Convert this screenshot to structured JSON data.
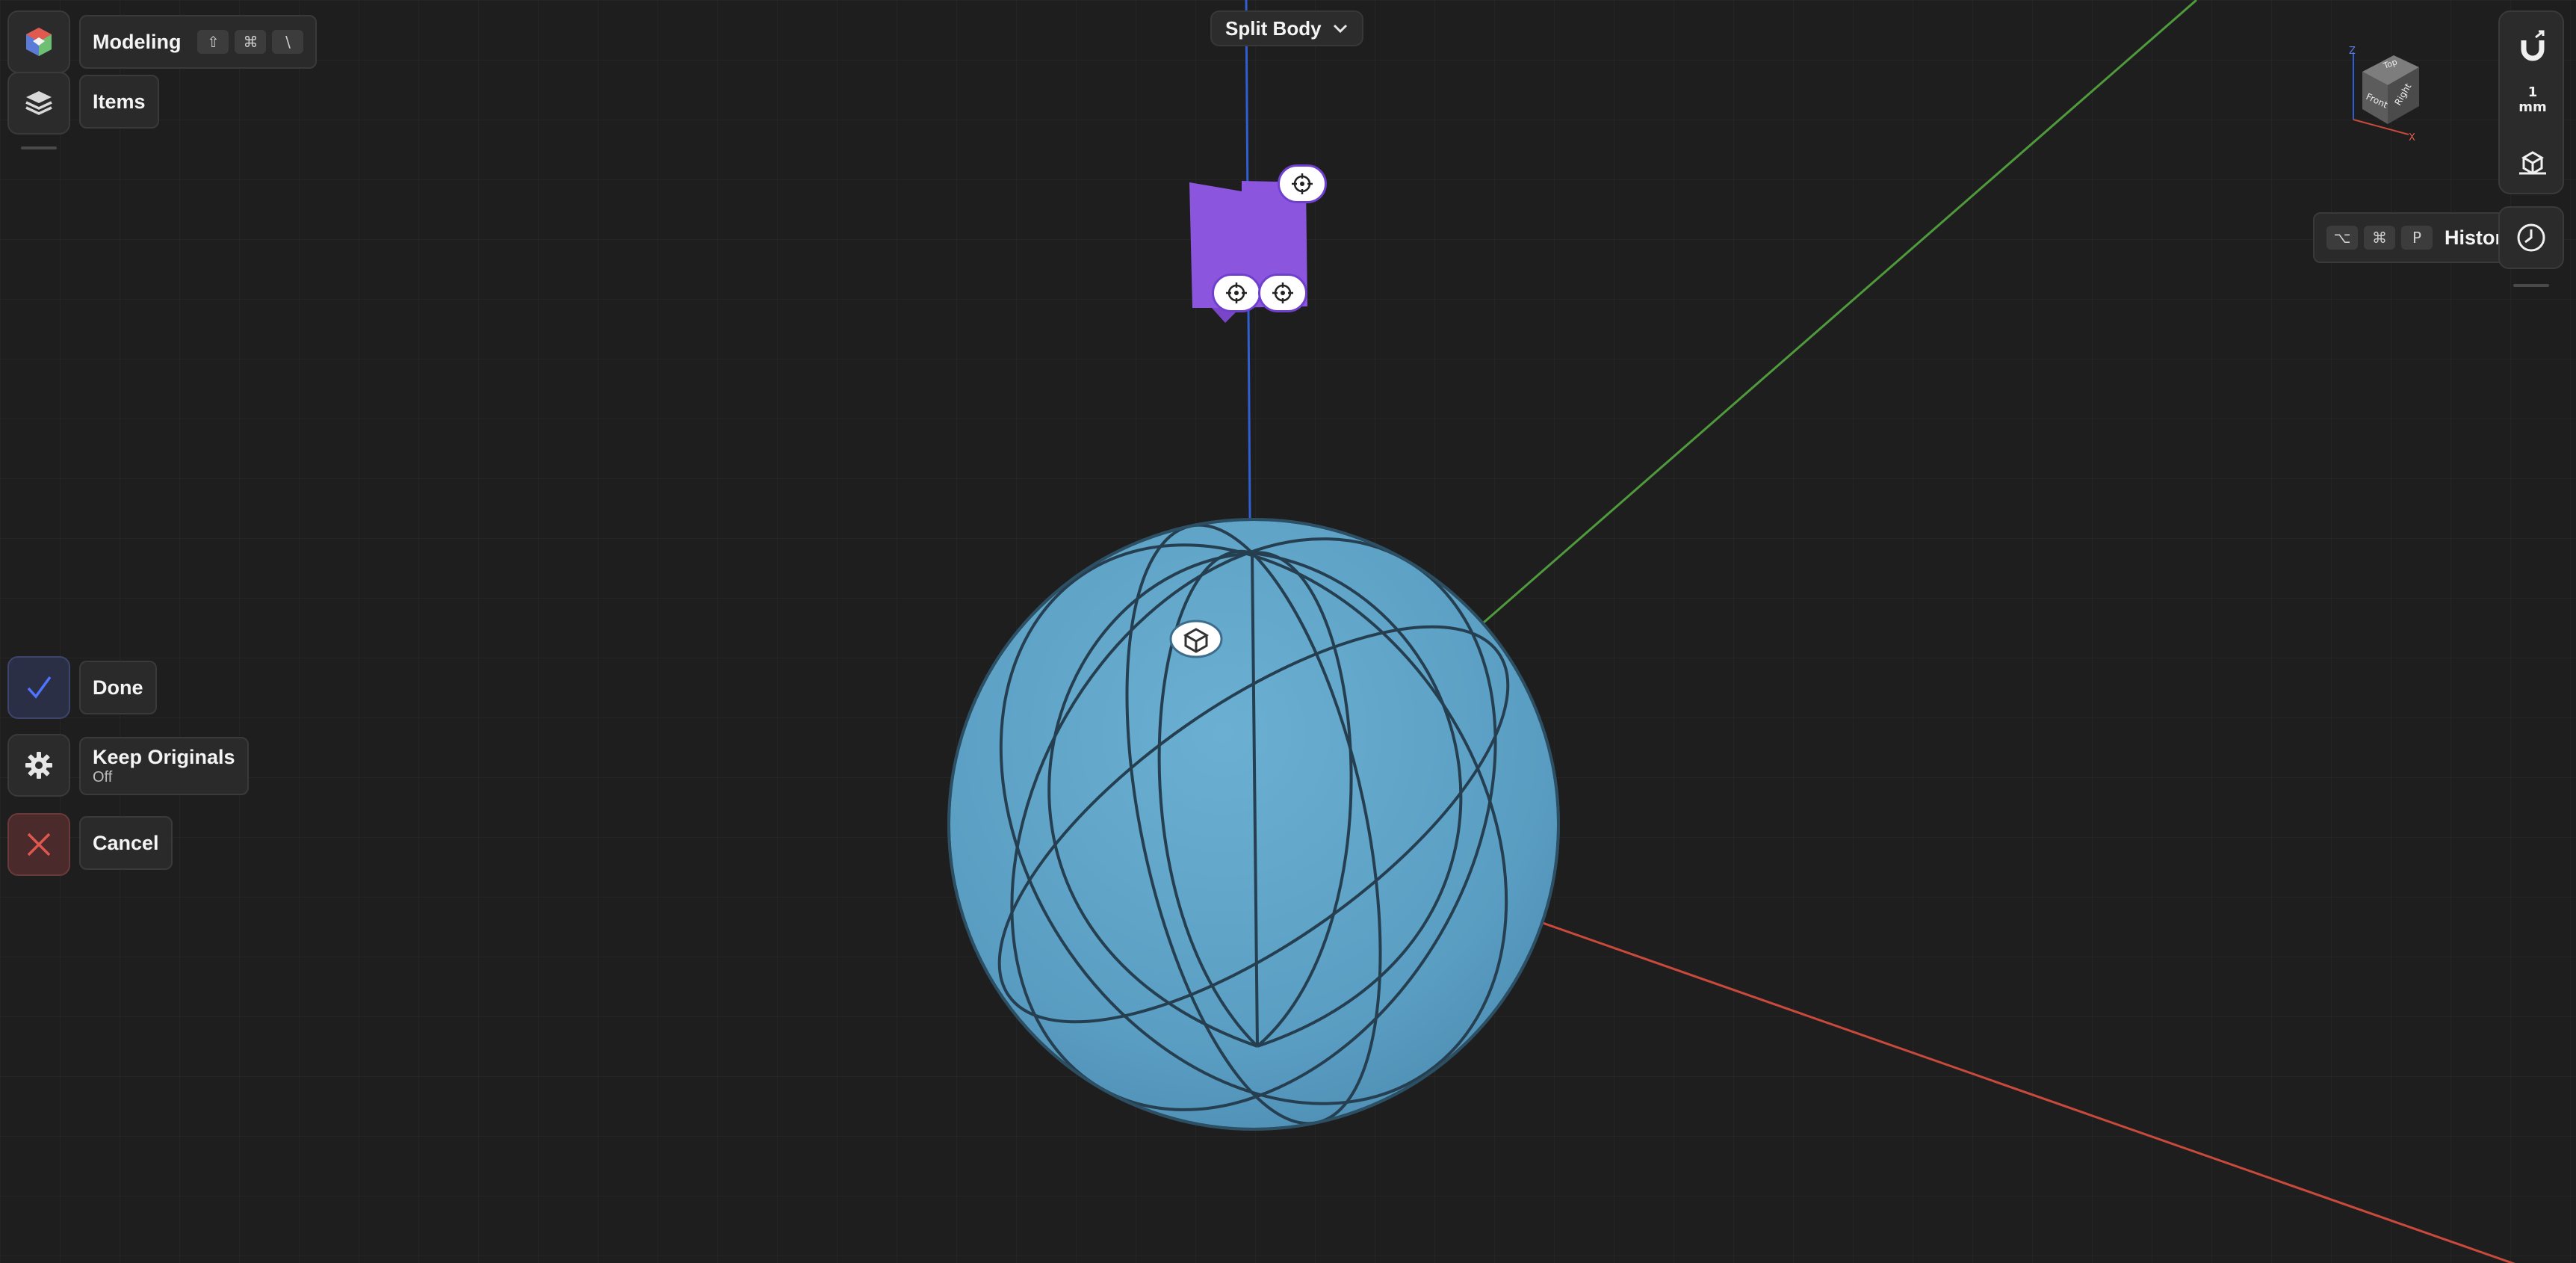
{
  "operation": {
    "title": "Split Body"
  },
  "workspace": {
    "mode_label": "Modeling",
    "mode_shortcut_keys": [
      "⇧",
      "⌘",
      "\\"
    ],
    "items_label": "Items"
  },
  "actions": {
    "done_label": "Done",
    "keep_originals_label": "Keep Originals",
    "keep_originals_value": "Off",
    "cancel_label": "Cancel"
  },
  "right_toolbar": {
    "units_value": "1",
    "units_label": "mm"
  },
  "history": {
    "label": "History",
    "shortcut_keys": [
      "⌥",
      "⌘",
      "P"
    ]
  },
  "view_cube": {
    "top_label": "Top",
    "front_label": "Front",
    "right_label": "Right",
    "axis_z_label": "Z",
    "axis_x_label": "X"
  },
  "colors": {
    "background": "#1e1e1e",
    "sphere": "#5fa3c7",
    "split_plane": "#8c55dd",
    "x_axis": "#c94a3c",
    "y_axis": "#4f9a3c",
    "z_axis": "#2f5fd0",
    "done_check": "#4f74ff",
    "cancel_cross": "#e0574f"
  },
  "icons": [
    "app-logo-icon",
    "layers-icon",
    "checkmark-icon",
    "gear-icon",
    "close-icon",
    "magnet-icon",
    "view-mode-icon",
    "history-clock-icon",
    "chevron-down-icon",
    "target-handle-icon",
    "body-select-icon"
  ]
}
